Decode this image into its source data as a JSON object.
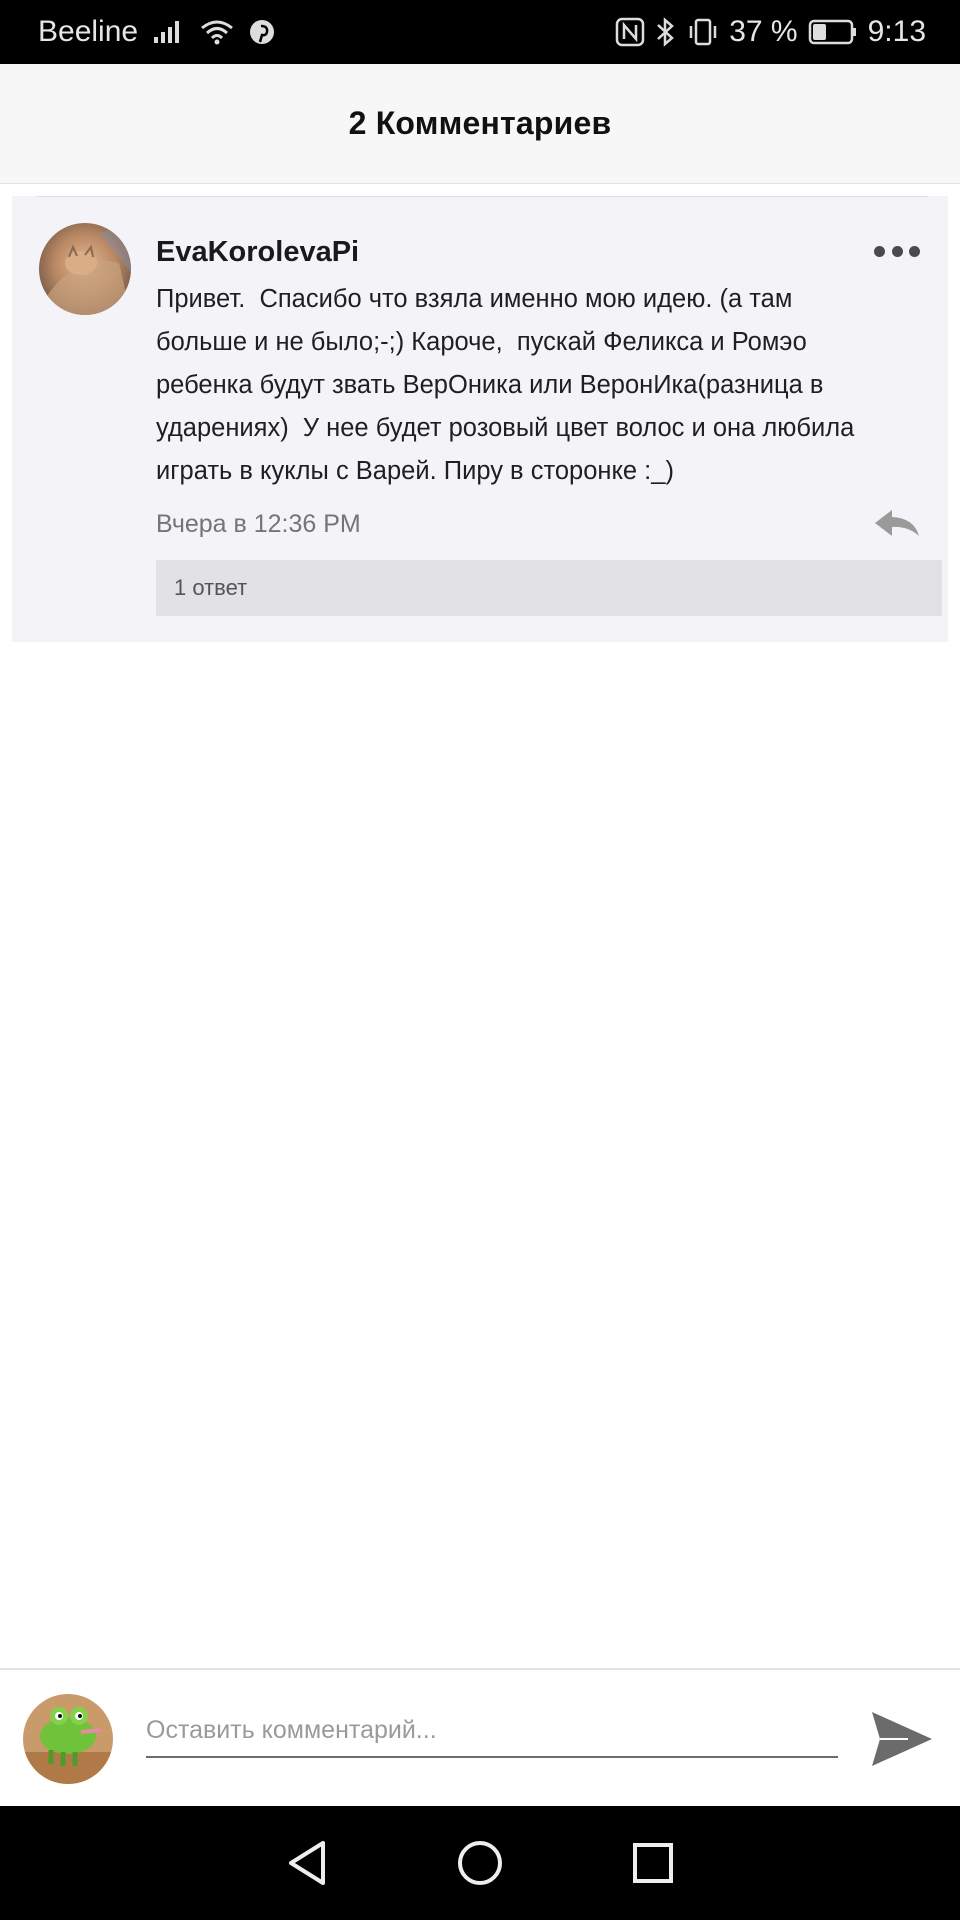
{
  "status_bar": {
    "carrier": "Beeline",
    "battery_percent": "37 %",
    "time": "9:13",
    "battery_level": 0.37,
    "icons": [
      "signal-icon",
      "wifi-icon",
      "pinterest-icon",
      "nfc-icon",
      "bluetooth-icon",
      "vibrate-icon",
      "battery-icon"
    ]
  },
  "header": {
    "title": "2 Комментариев"
  },
  "comment": {
    "author": "EvaKorolevaPi",
    "text": "Привет.  Спасибо что взяла именно мою идею. (а там\nбольше и не было;-;) Кароче,  пускай Феликса и Ромэо\nребенка будут звать ВерОника или ВеронИка(разница в\nударениях)  У нее будет розовый цвет волос и она любила\nиграть в куклы с Варей. Пиру в сторонке :_)",
    "timestamp": "Вчера в 12:36 PM",
    "replies_label": "1 ответ"
  },
  "composer": {
    "placeholder": "Оставить комментарий...",
    "value": ""
  },
  "colors": {
    "card_bg": "#f4f3f7",
    "replies_bg": "#e2e1e5",
    "header_bg": "#f7f7f7",
    "icon_gray": "#6b6b6b"
  }
}
